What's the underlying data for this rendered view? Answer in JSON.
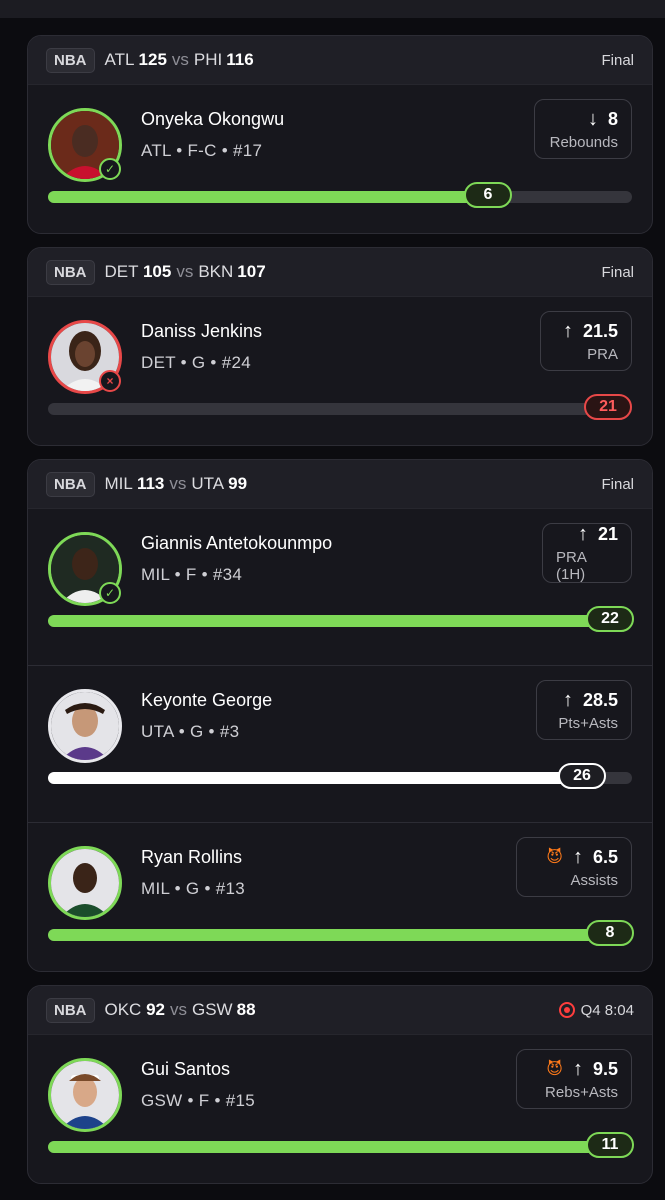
{
  "colors": {
    "hit": "#7ed957",
    "miss": "#e84848",
    "neutral": "#ffffff",
    "live": "#ff3d3d"
  },
  "games": [
    {
      "league": "NBA",
      "team1": "ATL",
      "score1": "125",
      "vs": "vs",
      "team2": "PHI",
      "score2": "116",
      "status": "Final",
      "players": [
        {
          "name": "Onyeka Okongwu",
          "info": "ATL • F-C • #17",
          "arrow": "↓",
          "line": "8",
          "label": "Rebounds",
          "actual": "6",
          "progress": 0.78,
          "result": "hit",
          "result_icon": "check-icon"
        }
      ]
    },
    {
      "league": "NBA",
      "team1": "DET",
      "score1": "105",
      "vs": "vs",
      "team2": "BKN",
      "score2": "107",
      "status": "Final",
      "players": [
        {
          "name": "Daniss Jenkins",
          "info": "DET • G • #24",
          "arrow": "↑",
          "line": "21.5",
          "label": "PRA",
          "actual": "21",
          "progress": 0,
          "result": "miss",
          "result_icon": "x-icon"
        }
      ]
    },
    {
      "league": "NBA",
      "team1": "MIL",
      "score1": "113",
      "vs": "vs",
      "team2": "UTA",
      "score2": "99",
      "status": "Final",
      "players": [
        {
          "name": "Giannis Antetokounmpo",
          "info": "MIL • F • #34",
          "arrow": "↑",
          "line": "21",
          "label": "PRA (1H)",
          "actual": "22",
          "progress": 1.0,
          "result": "hit",
          "result_icon": "check-icon"
        },
        {
          "name": "Keyonte George",
          "info": "UTA • G • #3",
          "arrow": "↑",
          "line": "28.5",
          "label": "Pts+Asts",
          "actual": "26",
          "progress": 0.93,
          "result": "neutral",
          "result_icon": ""
        },
        {
          "name": "Ryan Rollins",
          "info": "MIL • G • #13",
          "arrow": "↑",
          "line": "6.5",
          "label": "Assists",
          "actual": "8",
          "progress": 1.0,
          "result": "hit",
          "result_icon": "",
          "devil": "😈"
        }
      ]
    },
    {
      "league": "NBA",
      "team1": "OKC",
      "score1": "92",
      "vs": "vs",
      "team2": "GSW",
      "score2": "88",
      "status": "Q4 8:04",
      "live": true,
      "players": [
        {
          "name": "Gui Santos",
          "info": "GSW • F • #15",
          "arrow": "↑",
          "line": "9.5",
          "label": "Rebs+Asts",
          "actual": "11",
          "progress": 1.0,
          "result": "hit",
          "result_icon": "",
          "devil": "😈"
        }
      ]
    }
  ]
}
